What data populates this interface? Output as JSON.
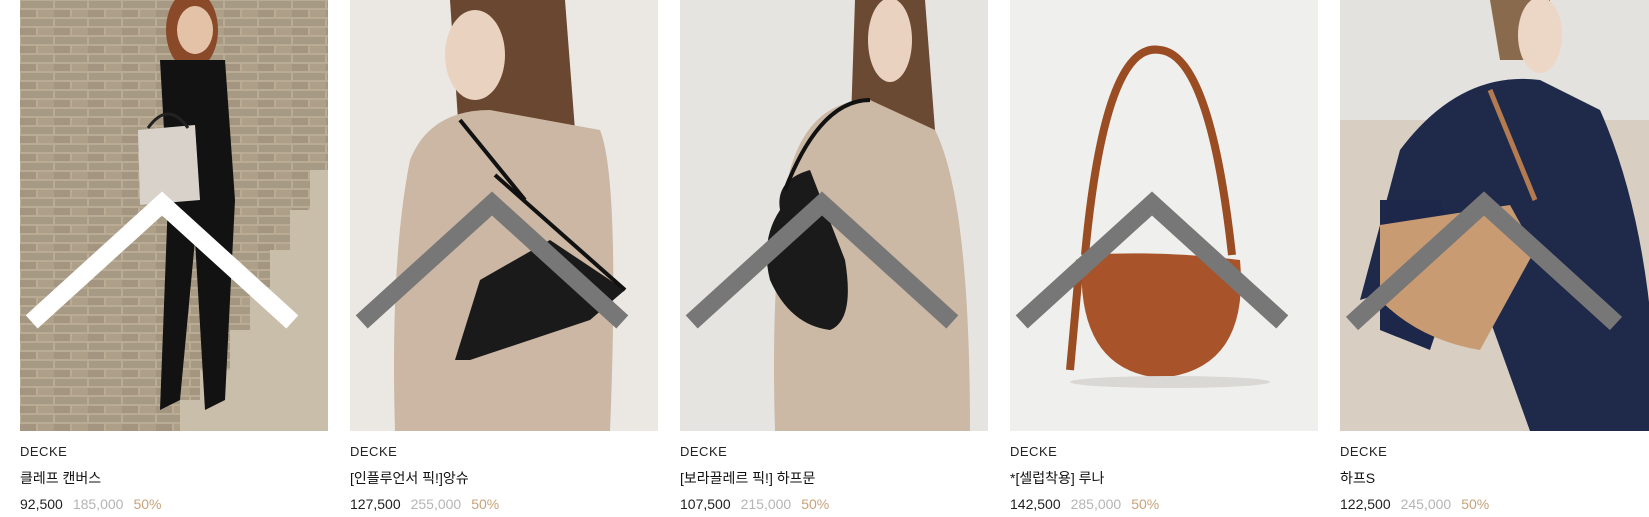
{
  "products": [
    {
      "brand": "DECKE",
      "name": "클레프 캔버스",
      "price": "92,500",
      "original_price": "185,000",
      "discount": "50%",
      "image_icon": "product-photo-canvas-bag"
    },
    {
      "brand": "DECKE",
      "name": "[인플루언서 픽!]앙슈",
      "price": "127,500",
      "original_price": "255,000",
      "discount": "50%",
      "image_icon": "product-photo-black-hobo"
    },
    {
      "brand": "DECKE",
      "name": "[보라끌레르 픽!] 하프문",
      "price": "107,500",
      "original_price": "215,000",
      "discount": "50%",
      "image_icon": "product-photo-halfmoon-bag"
    },
    {
      "brand": "DECKE",
      "name": "*[셀럽착용] 루나",
      "price": "142,500",
      "original_price": "285,000",
      "discount": "50%",
      "image_icon": "product-photo-brown-luna"
    },
    {
      "brand": "DECKE",
      "name": "하프S",
      "price": "122,500",
      "original_price": "245,000",
      "discount": "50%",
      "image_icon": "product-photo-beige-bucket"
    }
  ],
  "colors": {
    "discount": "#c8a27a",
    "original_price": "#b5b5b5"
  }
}
